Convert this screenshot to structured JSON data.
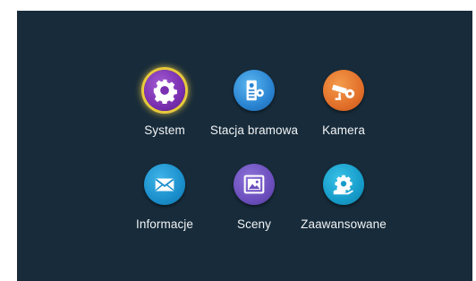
{
  "menu": {
    "items": [
      {
        "label": "System",
        "icon": "gear-icon",
        "color": "#7a2fb0",
        "selected": true
      },
      {
        "label": "Stacja bramowa",
        "icon": "door-station-icon",
        "color": "#2a84d2",
        "selected": false
      },
      {
        "label": "Kamera",
        "icon": "camera-icon",
        "color": "#e2702a",
        "selected": false
      },
      {
        "label": "Informacje",
        "icon": "envelope-icon",
        "color": "#1a8fcc",
        "selected": false
      },
      {
        "label": "Sceny",
        "icon": "gallery-icon",
        "color": "#6c4fbd",
        "selected": false
      },
      {
        "label": "Zaawansowane",
        "icon": "hand-gear-icon",
        "color": "#169cca",
        "selected": false
      }
    ]
  },
  "theme": {
    "background": "#172b3a",
    "selection_glow": "#e7c93c"
  }
}
